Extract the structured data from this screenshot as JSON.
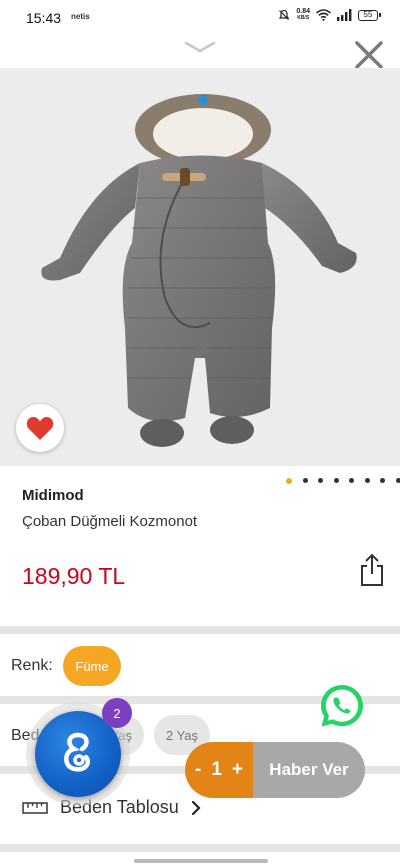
{
  "status_bar": {
    "time": "15:43",
    "app_label": "netis",
    "net_speed_value": "0.84",
    "net_speed_unit": "KB/S",
    "battery": "55"
  },
  "product": {
    "brand": "Midimod",
    "name": "Çoban Düğmeli Kozmonot",
    "price": "189,90 TL",
    "image_count": 8,
    "active_image_index": 0
  },
  "options": {
    "color_label": "Renk:",
    "color_value": "Füme",
    "size_label": "Beden:",
    "sizes": [
      "1 Yaş",
      "2 Yaş"
    ],
    "size_table_label": "Beden Tablosu"
  },
  "widgets": {
    "chat_badge_count": "2",
    "qty_minus": "-",
    "qty_value": "1",
    "qty_plus": "+",
    "notify_label": "Haber Ver"
  },
  "colors": {
    "accent_orange": "#f5a623",
    "price_red": "#d0021b",
    "notify_gray": "#a8a8a8",
    "qty_orange": "#e38417",
    "chat_blue": "#1463c9",
    "badge_purple": "#7b3fc0",
    "whatsapp_green": "#25d366"
  },
  "icons": [
    "chevron-down-icon",
    "close-icon",
    "heart-icon",
    "share-icon",
    "ruler-icon",
    "chevron-right-icon",
    "chat-logo-icon",
    "whatsapp-icon"
  ]
}
